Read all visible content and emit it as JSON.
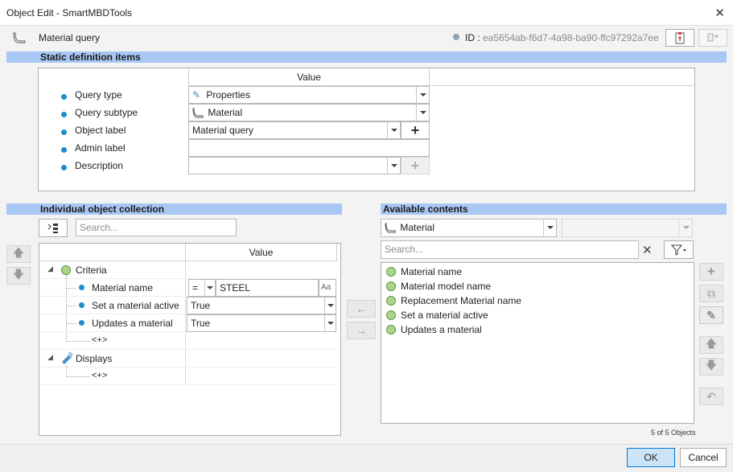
{
  "window": {
    "title": "Object Edit - SmartMBDTools",
    "close_icon": "close-icon"
  },
  "header": {
    "object_label": "Material query",
    "id_label": "ID :",
    "id_value": "ea5654ab-f6d7-4a98-ba90-ffc97292a7ee"
  },
  "static_section": {
    "title": "Static definition items",
    "value_header": "Value",
    "rows": [
      {
        "label": "Query type",
        "value": "Properties"
      },
      {
        "label": "Query subtype",
        "value": "Material"
      },
      {
        "label": "Object label",
        "value": "Material query"
      },
      {
        "label": "Admin label",
        "value": ""
      },
      {
        "label": "Description",
        "value": ""
      }
    ],
    "plus_symbol": "+"
  },
  "collection": {
    "title": "Individual object collection",
    "search_placeholder": "Search...",
    "value_header": "Value",
    "criteria_label": "Criteria",
    "criteria_rows": [
      {
        "label": "Material name",
        "operator": "=",
        "value": "STEEL",
        "case_label": "Aa"
      },
      {
        "label": "Set a material active",
        "value": "True"
      },
      {
        "label": "Updates a material",
        "value": "True"
      }
    ],
    "add_placeholder": "<+>",
    "displays_label": "Displays",
    "displays_add": "<+>"
  },
  "available": {
    "title": "Available contents",
    "category": "Material",
    "search_placeholder": "Search...",
    "clear_symbol": "✕",
    "items": [
      "Material name",
      "Material model name",
      "Replacement Material name",
      "Set a material active",
      "Updates a material"
    ],
    "count_text": "5 of 5 Objects"
  },
  "footer": {
    "ok_label": "OK",
    "cancel_label": "Cancel"
  },
  "colors": {
    "section_bar": "#a9c7f5",
    "dot_blue": "#1b8fc9",
    "dot_green": "#aad58b",
    "primary_button": "#cce4f7"
  }
}
